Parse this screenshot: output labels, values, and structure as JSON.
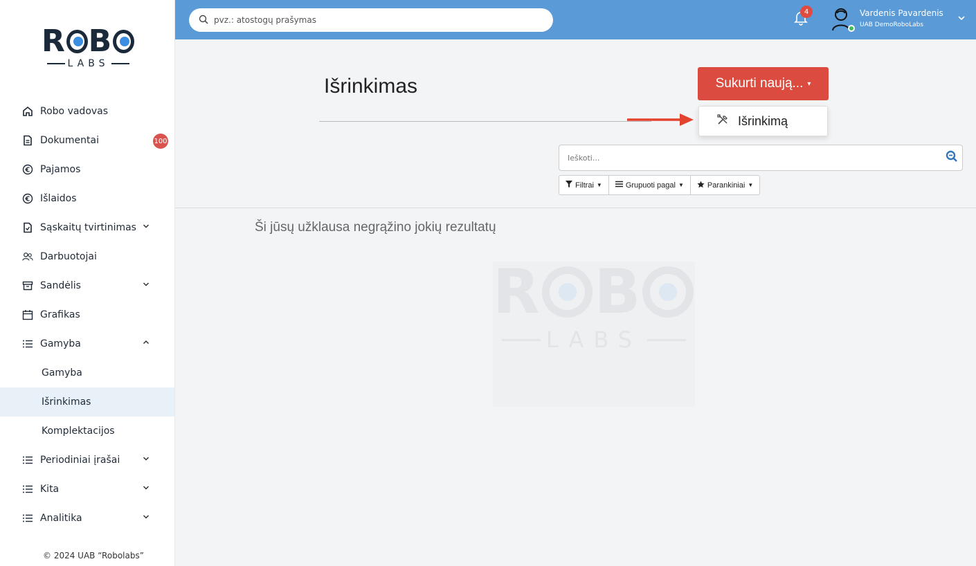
{
  "brand": {
    "word_left": "R",
    "word_mid": "B",
    "sub": "LABS"
  },
  "topbar": {
    "search_placeholder": "pvz.: atostogų prašymas",
    "notifications_count": "4",
    "user_name": "Vardenis Pavardenis",
    "user_company": "UAB DemoRoboLabs"
  },
  "sidebar": {
    "items": [
      {
        "label": "Robo vadovas",
        "icon": "home-icon"
      },
      {
        "label": "Dokumentai",
        "icon": "document-icon",
        "badge": "100"
      },
      {
        "label": "Pajamos",
        "icon": "euro-circle-icon"
      },
      {
        "label": "Išlaidos",
        "icon": "euro-circle-icon"
      },
      {
        "label": "Sąskaitų tvirtinimas",
        "icon": "check-file-icon"
      },
      {
        "label": "Darbuotojai",
        "icon": "users-icon"
      },
      {
        "label": "Sandėlis",
        "icon": "archive-icon"
      },
      {
        "label": "Grafikas",
        "icon": "calendar-icon"
      },
      {
        "label": "Gamyba",
        "icon": "list-icon"
      }
    ],
    "sub_items": [
      {
        "label": "Gamyba"
      },
      {
        "label": "Išrinkimas"
      },
      {
        "label": "Komplektacijos"
      }
    ],
    "items_after": [
      {
        "label": "Periodiniai įrašai",
        "icon": "list-icon"
      },
      {
        "label": "Kita",
        "icon": "list-icon"
      },
      {
        "label": "Analitika",
        "icon": "list-icon"
      }
    ],
    "copyright": "© 2024 UAB “Robolabs”"
  },
  "main": {
    "title": "Išrinkimas",
    "create_button": "Sukurti naują...",
    "dropdown_item": "Išrinkimą",
    "search_placeholder": "Ieškoti...",
    "filters": [
      {
        "label": "Filtrai",
        "icon": "filter-icon"
      },
      {
        "label": "Grupuoti pagal",
        "icon": "bars-icon"
      },
      {
        "label": "Parankiniai",
        "icon": "star-icon"
      }
    ],
    "empty_message": "Ši jūsų užklausa negrąžino jokių rezultatų"
  },
  "colors": {
    "topbar": "#5a9ad6",
    "accent_red": "#db4b3f",
    "active_item_bg": "#e8f1f8",
    "online": "#3bbf59"
  }
}
